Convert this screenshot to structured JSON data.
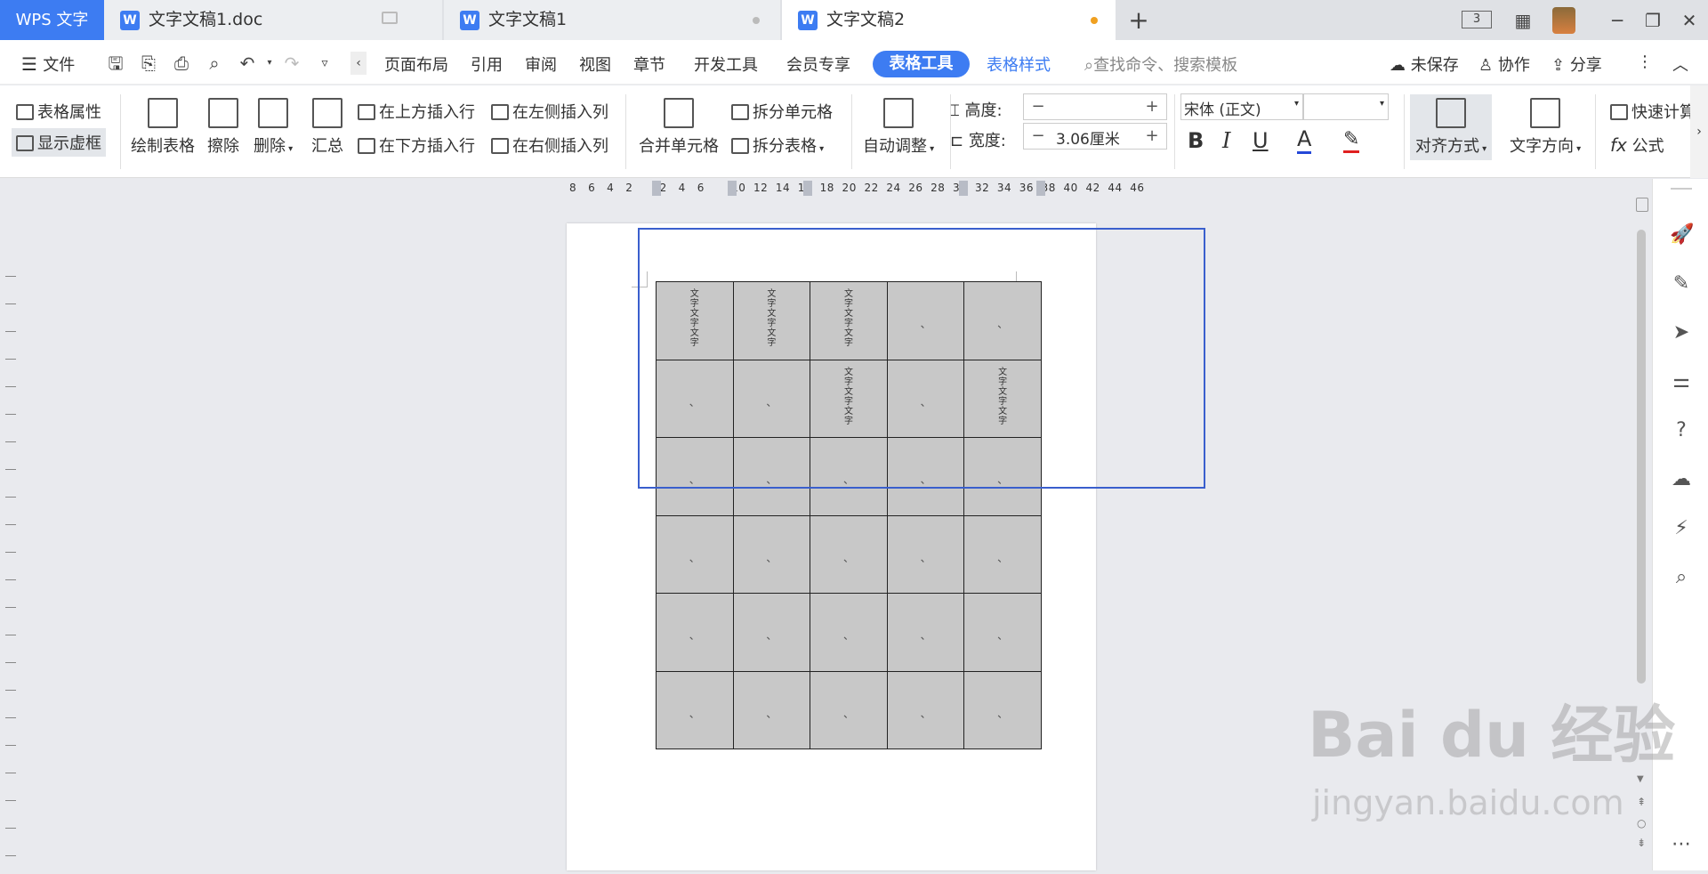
{
  "tabs": {
    "app": "WPS 文字",
    "doc1": "文字文稿1.doc",
    "doc2": "文字文稿1",
    "doc3": "文字文稿2",
    "new": "+",
    "page_badge": "3"
  },
  "menu": {
    "file": "文件",
    "items": [
      "页面布局",
      "引用",
      "审阅",
      "视图",
      "章节",
      "开发工具",
      "会员专享"
    ],
    "table_tools": "表格工具",
    "table_style": "表格样式",
    "search_placeholder": "查找命令、搜索模板",
    "unsaved": "未保存",
    "collab": "协作",
    "share": "分享"
  },
  "ribbon": {
    "table_props": "表格属性",
    "show_grid": "显示虚框",
    "draw_table": "绘制表格",
    "erase": "擦除",
    "delete": "删除",
    "summary": "汇总",
    "insert_above": "在上方插入行",
    "insert_below": "在下方插入行",
    "insert_left": "在左侧插入列",
    "insert_right": "在右侧插入列",
    "merge_cells": "合并单元格",
    "split_cells": "拆分单元格",
    "split_table": "拆分表格",
    "auto_adjust": "自动调整",
    "height_label": "高度:",
    "width_label": "宽度:",
    "width_value": "3.06厘米",
    "font_name": "宋体 (正文)",
    "font_size": "",
    "bold": "B",
    "italic": "I",
    "underline": "U",
    "font_color": "A",
    "align": "对齐方式",
    "text_direction": "文字方向",
    "quick_calc": "快速计算",
    "formula": "公式",
    "fx": "fx"
  },
  "ruler": "8   6   4   2       2   4   6       10  12  14  16  18  20  22  24  26  28  30  32  34  36  38  40  42  44  46",
  "table": {
    "cells": [
      [
        "文字文字文字",
        "文字文字文字",
        "文字文字文字",
        "",
        ""
      ],
      [
        "",
        "",
        "文字文字文字",
        "",
        "文字文字文字"
      ],
      [
        "",
        "",
        "",
        "",
        ""
      ],
      [
        "",
        "",
        "",
        "",
        ""
      ],
      [
        "",
        "",
        "",
        "",
        ""
      ],
      [
        "",
        "",
        "",
        "",
        ""
      ]
    ]
  },
  "watermark": {
    "main": "Bai du 经验",
    "sub": "jingyan.baidu.com"
  },
  "colors": {
    "accent": "#3d7cf2",
    "selection": "#3a5fcd",
    "table_fill": "#c8c8c8",
    "modified_dot": "#f0a020"
  }
}
